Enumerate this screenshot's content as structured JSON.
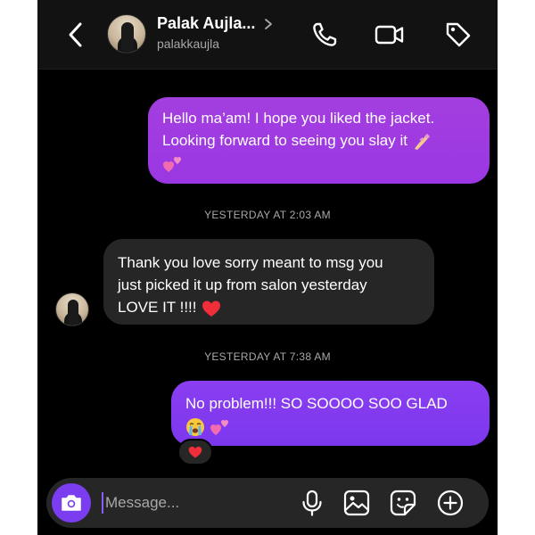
{
  "header": {
    "name": "Palak Aujla...",
    "username": "palakkaujla",
    "icons": [
      "back-icon",
      "chevron-right-icon",
      "phone-icon",
      "video-icon",
      "tag-icon"
    ]
  },
  "messages": [
    {
      "direction": "outgoing",
      "line1": "Hello ma’am! I hope you liked the jacket.",
      "line2": "Looking forward to seeing you slay it",
      "emojis": [
        "nail-polish-emoji",
        "two-hearts-emoji"
      ]
    },
    {
      "timestamp": "YESTERDAY AT 2:03 AM"
    },
    {
      "direction": "incoming",
      "line1": "Thank you love sorry meant to msg you",
      "line2": "just picked it up from salon yesterday",
      "line3": "LOVE IT !!!!",
      "emojis": [
        "red-heart-emoji"
      ]
    },
    {
      "timestamp": "YESTERDAY AT 7:38 AM"
    },
    {
      "direction": "outgoing",
      "line1": "No problem!!! SO SOOOO SOO GLAD",
      "emojis": [
        "loudly-crying-face-emoji",
        "two-hearts-emoji"
      ],
      "reaction": "red-heart-emoji"
    }
  ],
  "composer": {
    "placeholder": "Message...",
    "icons": [
      "camera-icon",
      "microphone-icon",
      "gallery-icon",
      "sticker-icon",
      "plus-icon"
    ]
  },
  "colors": {
    "outgoing_bubble_top": "#a33ee0",
    "outgoing_bubble_bottom": "#7c37ee",
    "incoming_bubble": "#262626",
    "background": "#000000",
    "camera_button": "#7a3ef0"
  }
}
